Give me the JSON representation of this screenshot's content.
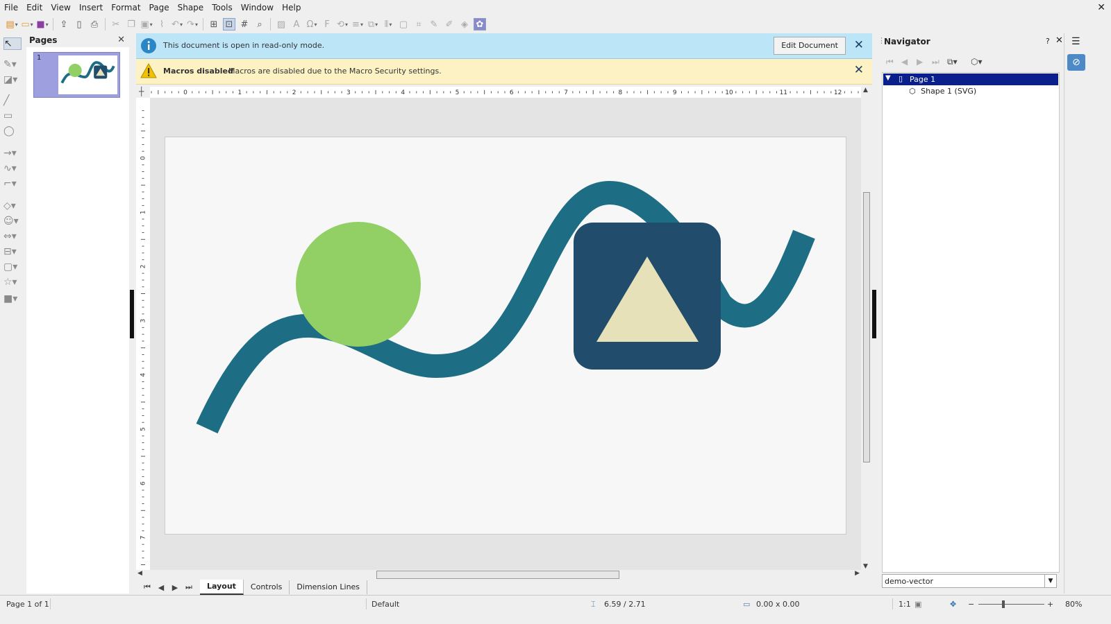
{
  "menu": [
    "File",
    "Edit",
    "View",
    "Insert",
    "Format",
    "Page",
    "Shape",
    "Tools",
    "Window",
    "Help"
  ],
  "pages_panel": {
    "title": "Pages",
    "slide_number": "1"
  },
  "infobar_readonly": {
    "message": "This document is open in read-only mode.",
    "button": "Edit Document"
  },
  "infobar_macros": {
    "title": "Macros disabled",
    "message": "Macros are disabled due to the Macro Security settings."
  },
  "ruler": {
    "h_ticks": [
      "0",
      "1",
      "2",
      "3",
      "4",
      "5",
      "6",
      "7",
      "8",
      "9",
      "10",
      "11",
      "12"
    ],
    "v_ticks": [
      "0",
      "1",
      "2",
      "3",
      "4",
      "5",
      "6",
      "7"
    ]
  },
  "drawing": {
    "colors": {
      "curve": "#1d6e84",
      "circle": "#92cf64",
      "square": "#214c6c",
      "triangle": "#e6e1b8",
      "page": "#f7f7f7"
    }
  },
  "tabs": [
    {
      "label": "Layout",
      "active": true
    },
    {
      "label": "Controls",
      "active": false
    },
    {
      "label": "Dimension Lines",
      "active": false
    }
  ],
  "navigator": {
    "title": "Navigator",
    "help": "?",
    "tree": {
      "page": "Page 1",
      "shape": "Shape 1 (SVG)"
    },
    "document": "demo-vector"
  },
  "status": {
    "page": "Page 1 of 1",
    "layout": "Default",
    "position": "6.59 / 2.71",
    "size": "0.00 x 0.00",
    "scale": "1:1",
    "zoom": "80%"
  }
}
